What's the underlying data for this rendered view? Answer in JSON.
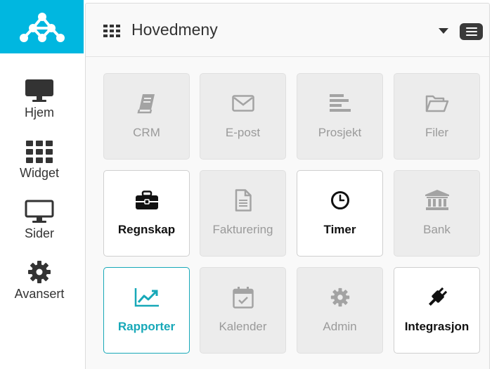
{
  "sidebar": {
    "logo": "network-logo",
    "items": [
      {
        "label": "Hjem",
        "icon": "monitor-icon"
      },
      {
        "label": "Widget",
        "icon": "grid-icon"
      },
      {
        "label": "Sider",
        "icon": "monitor-outline-icon"
      },
      {
        "label": "Avansert",
        "icon": "gear-icon"
      }
    ]
  },
  "header": {
    "title": "Hovedmeny"
  },
  "tiles": [
    {
      "label": "CRM",
      "icon": "book-icon",
      "state": "disabled"
    },
    {
      "label": "E-post",
      "icon": "envelope-icon",
      "state": "disabled"
    },
    {
      "label": "Prosjekt",
      "icon": "align-left-icon",
      "state": "disabled"
    },
    {
      "label": "Filer",
      "icon": "folder-open-icon",
      "state": "disabled"
    },
    {
      "label": "Regnskap",
      "icon": "briefcase-icon",
      "state": "enabled"
    },
    {
      "label": "Fakturering",
      "icon": "document-icon",
      "state": "disabled"
    },
    {
      "label": "Timer",
      "icon": "clock-icon",
      "state": "enabled"
    },
    {
      "label": "Bank",
      "icon": "bank-icon",
      "state": "disabled"
    },
    {
      "label": "Rapporter",
      "icon": "line-chart-icon",
      "state": "active"
    },
    {
      "label": "Kalender",
      "icon": "calendar-check-icon",
      "state": "disabled"
    },
    {
      "label": "Admin",
      "icon": "gear-icon",
      "state": "disabled"
    },
    {
      "label": "Integrasjon",
      "icon": "plug-icon",
      "state": "enabled"
    }
  ],
  "colors": {
    "brand": "#00b7e0",
    "accent": "#17a8b8",
    "disabled_text": "#9a9a9a"
  }
}
